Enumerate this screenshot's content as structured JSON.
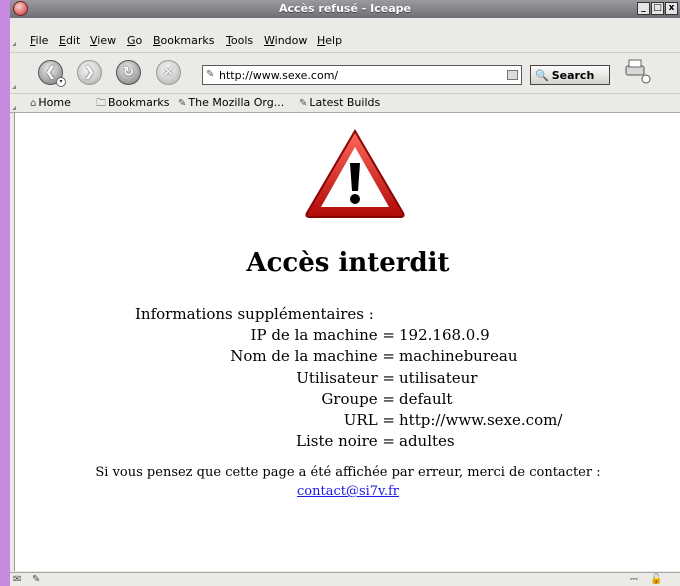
{
  "window": {
    "title": "Accès refusé - Iceape"
  },
  "menu": [
    {
      "label": "File",
      "key": "F",
      "rest": "ile"
    },
    {
      "label": "Edit",
      "key": "E",
      "rest": "dit"
    },
    {
      "label": "View",
      "key": "V",
      "rest": "iew"
    },
    {
      "label": "Go",
      "key": "G",
      "rest": "o"
    },
    {
      "label": "Bookmarks",
      "key": "B",
      "rest": "ookmarks"
    },
    {
      "label": "Tools",
      "key": "T",
      "rest": "ools"
    },
    {
      "label": "Window",
      "key": "W",
      "rest": "indow"
    },
    {
      "label": "Help",
      "key": "H",
      "rest": "elp"
    }
  ],
  "navbar": {
    "url": "http://www.sexe.com/",
    "search_label": "Search"
  },
  "bookmarks": [
    {
      "label": "Home",
      "icon": "home-icon"
    },
    {
      "label": "Bookmarks",
      "icon": "folder-icon"
    },
    {
      "label": "The Mozilla Org...",
      "icon": "bookmark-icon"
    },
    {
      "label": "Latest Builds",
      "icon": "bookmark-icon"
    }
  ],
  "page": {
    "heading": "Accès interdit",
    "info_label": "Informations supplémentaires :",
    "rows": [
      {
        "key": "IP de la machine =",
        "value": "192.168.0.9"
      },
      {
        "key": "Nom de la machine =",
        "value": "machinebureau"
      },
      {
        "key": "Utilisateur =",
        "value": "utilisateur"
      },
      {
        "key": "Groupe =",
        "value": "default"
      },
      {
        "key": "URL =",
        "value": "http://www.sexe.com/"
      },
      {
        "key": "Liste noire =",
        "value": "adultes"
      }
    ],
    "message": "Si vous pensez que cette page a été affichée par erreur, merci de contacter :",
    "contact": "contact@si7v.fr"
  },
  "colors": {
    "desktop": "#c88ae0",
    "warning_red": "#d01818",
    "link": "#1a1ae6"
  }
}
